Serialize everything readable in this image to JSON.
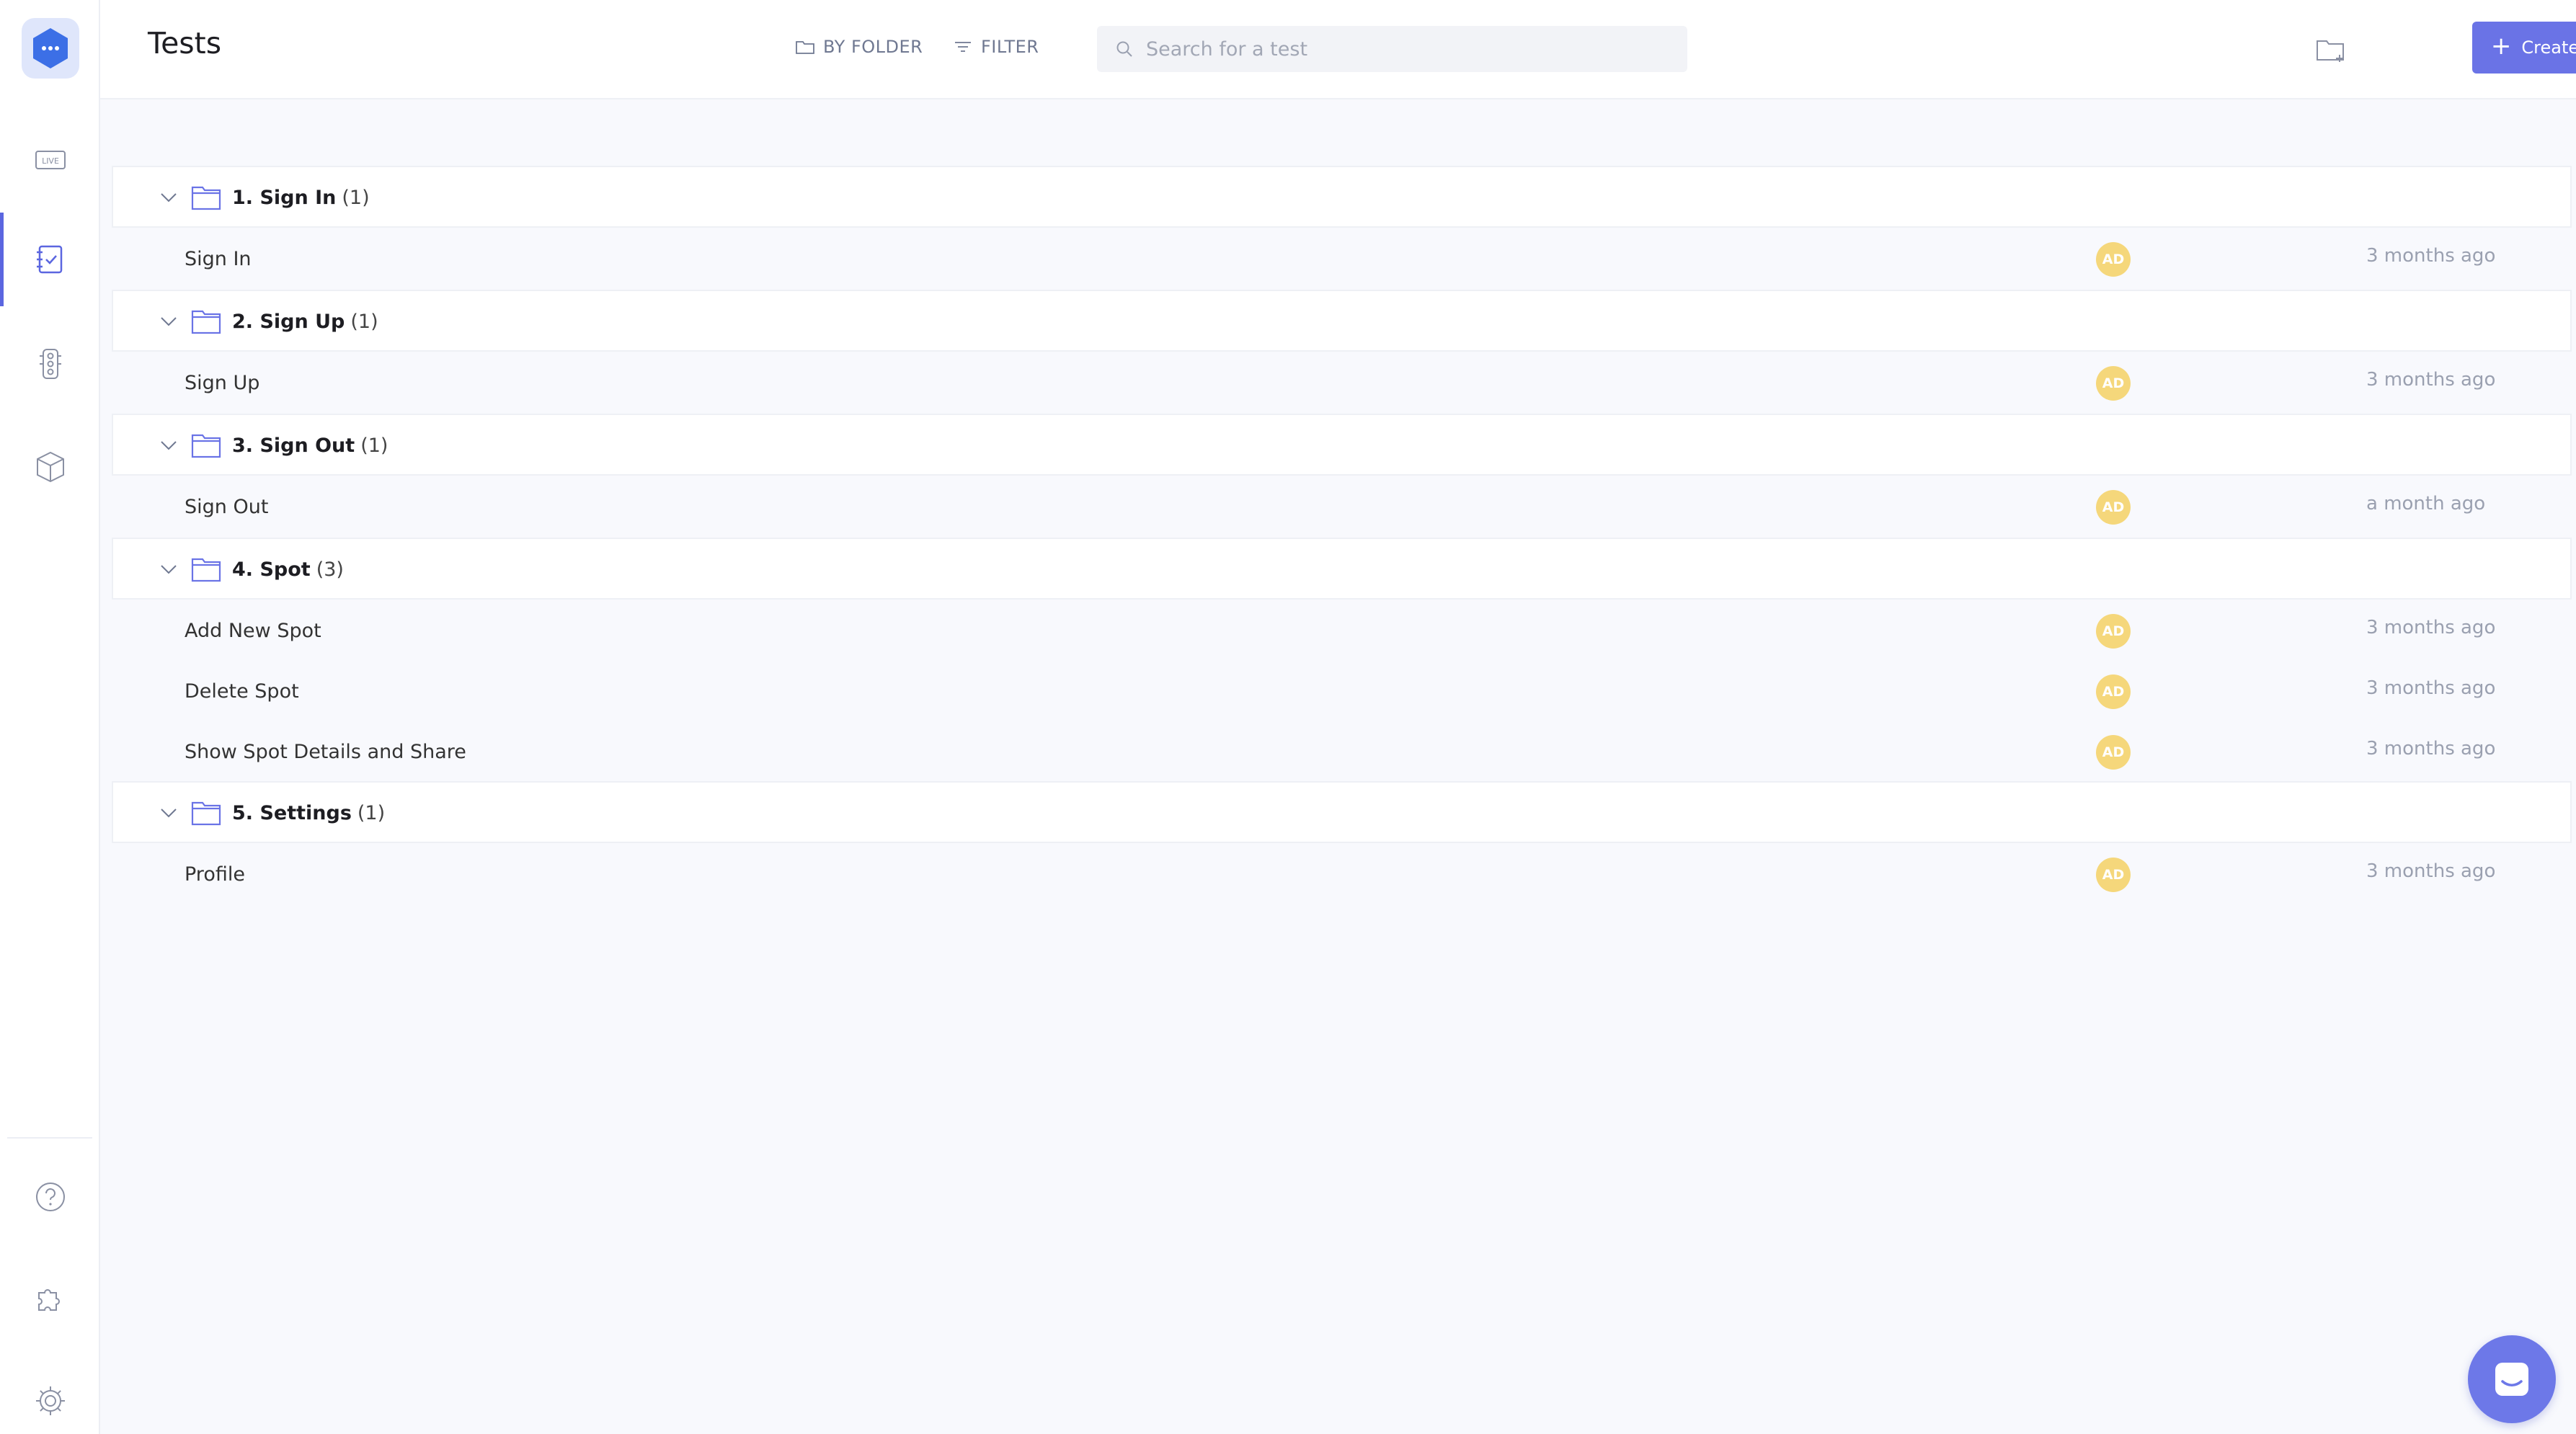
{
  "header": {
    "title": "Tests",
    "by_folder_label": "BY FOLDER",
    "filter_label": "FILTER",
    "search_placeholder": "Search for a test",
    "create_label": "Create Test"
  },
  "sidebar": {
    "active_item": "tests",
    "items": [
      "live-icon",
      "tests-icon",
      "traffic-light-icon",
      "package-icon",
      "help-icon",
      "plugin-icon",
      "settings-icon"
    ]
  },
  "folders": [
    {
      "name": "1. Sign In",
      "count": "(1)",
      "tests": [
        {
          "name": "Sign In",
          "owner": "AD",
          "updated": "3 months ago"
        }
      ]
    },
    {
      "name": "2. Sign Up",
      "count": "(1)",
      "tests": [
        {
          "name": "Sign Up",
          "owner": "AD",
          "updated": "3 months ago"
        }
      ]
    },
    {
      "name": "3. Sign Out",
      "count": "(1)",
      "tests": [
        {
          "name": "Sign Out",
          "owner": "AD",
          "updated": "a month ago"
        }
      ]
    },
    {
      "name": "4. Spot",
      "count": "(3)",
      "tests": [
        {
          "name": "Add New Spot",
          "owner": "AD",
          "updated": "3 months ago"
        },
        {
          "name": "Delete Spot",
          "owner": "AD",
          "updated": "3 months ago"
        },
        {
          "name": "Show Spot Details and Share",
          "owner": "AD",
          "updated": "3 months ago"
        }
      ]
    },
    {
      "name": "5. Settings",
      "count": "(1)",
      "tests": [
        {
          "name": "Profile",
          "owner": "AD",
          "updated": "3 months ago"
        }
      ]
    }
  ],
  "colors": {
    "accent": "#6a73e6",
    "avatar": "#f5d77b",
    "logo": "#3c6fe6"
  }
}
